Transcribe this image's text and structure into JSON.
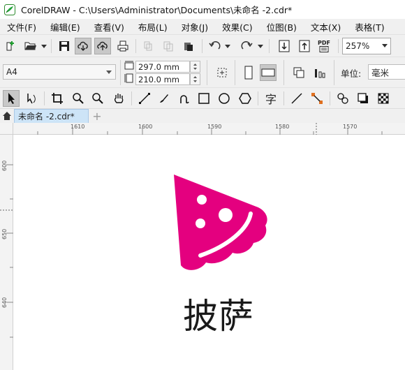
{
  "window": {
    "title": "CorelDRAW - C:\\Users\\Administrator\\Documents\\未命名 -2.cdr*"
  },
  "menu": [
    "文件(F)",
    "编辑(E)",
    "查看(V)",
    "布局(L)",
    "对象(J)",
    "效果(C)",
    "位图(B)",
    "文本(X)",
    "表格(T)"
  ],
  "toolbar": {
    "zoom_value": "257%",
    "icons": [
      "new-document-icon",
      "open-icon",
      "save-icon",
      "cloud-download-icon",
      "cloud-upload-icon",
      "print-icon",
      "cut-icon",
      "copy-icon",
      "paste-icon",
      "undo-icon",
      "redo-icon",
      "import-icon",
      "export-icon",
      "pdf-icon"
    ],
    "pdf_label": "PDF"
  },
  "property_bar": {
    "page_size": "A4",
    "width": "297.0 mm",
    "height": "210.0 mm",
    "unit_label": "单位:",
    "unit_value": "毫米"
  },
  "tools": [
    "pick-tool-icon",
    "shape-tool-icon",
    "crop-tool-icon",
    "zoom-tool-icon",
    "zoom-out-icon",
    "pan-tool-icon",
    "freehand-tool-icon",
    "artistic-media-icon",
    "bezier-curve-icon",
    "rectangle-tool-icon",
    "ellipse-tool-icon",
    "polygon-tool-icon",
    "text-tool-icon",
    "dimension-tool-icon",
    "connector-tool-icon",
    "blend-tool-icon",
    "drop-shadow-icon",
    "transparency-icon"
  ],
  "text_tool_glyph": "字",
  "tabs": {
    "document": "未命名 -2.cdr*",
    "add": "+"
  },
  "rulers": {
    "horizontal": [
      "1610",
      "1600",
      "1590",
      "1580",
      "1570"
    ],
    "vertical": [
      "600",
      "650",
      "640"
    ]
  },
  "artwork": {
    "brand_text": "披萨",
    "brand_color": "#e4007f",
    "logo_icon": "pizza-slice-icon"
  }
}
